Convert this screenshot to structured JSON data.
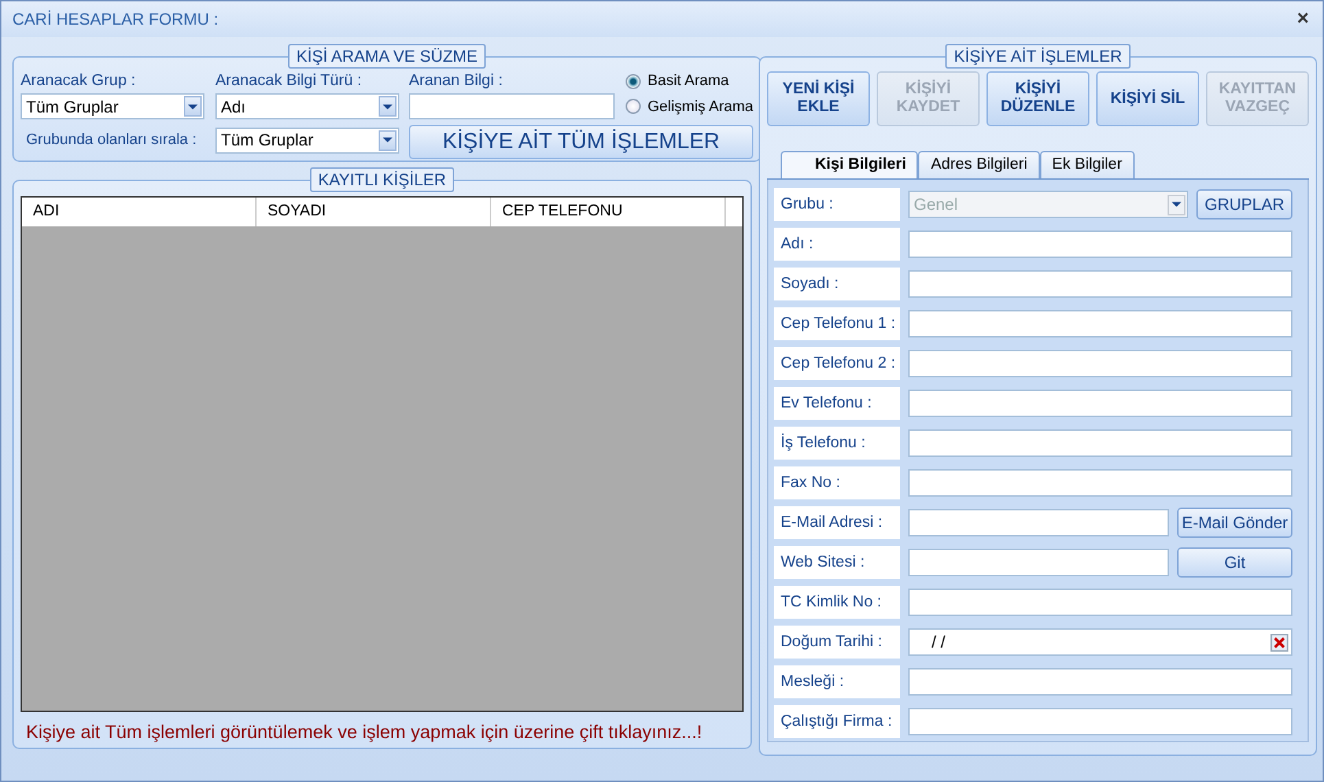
{
  "window": {
    "title": "CARİ HESAPLAR FORMU :",
    "close": "×"
  },
  "search": {
    "title": "KİŞİ ARAMA VE SÜZME",
    "group_label": "Aranacak Grup :",
    "group_value": "Tüm Gruplar",
    "type_label": "Aranacak Bilgi Türü :",
    "type_value": "Adı",
    "query_label": "Aranan Bilgi :",
    "modes": [
      {
        "label": "Basit Arama",
        "selected": true
      },
      {
        "label": "Gelişmiş Arama",
        "selected": false
      }
    ],
    "sort_label": "Grubunda olanları sırala :",
    "sort_value": "Tüm Gruplar",
    "all_button": "KİŞİYE AİT TÜM İŞLEMLER"
  },
  "list": {
    "title": "KAYITLI KİŞİLER",
    "columns": [
      "ADI",
      "SOYADI",
      "CEP TELEFONU"
    ],
    "hint": "Kişiye ait Tüm işlemleri görüntülemek ve işlem yapmak için üzerine çift tıklayınız...!"
  },
  "actions": {
    "title": "KİŞİYE AİT İŞLEMLER",
    "buttons": [
      {
        "label": "YENİ KİŞİ EKLE",
        "disabled": false
      },
      {
        "label": "KİŞİYİ KAYDET",
        "disabled": true
      },
      {
        "label": "KİŞİYİ DÜZENLE",
        "disabled": false
      },
      {
        "label": "KİŞİYİ SİL",
        "disabled": false
      },
      {
        "label": "KAYITTAN VAZGEÇ",
        "disabled": true
      }
    ],
    "tabs": [
      {
        "label": "Kişi Bilgileri",
        "selected": true
      },
      {
        "label": "Adres Bilgileri",
        "selected": false
      },
      {
        "label": "Ek Bilgiler",
        "selected": false
      }
    ],
    "fields": [
      {
        "label": "Grubu :",
        "kind": "combo",
        "value": "Genel",
        "disabled": true,
        "button": "GRUPLAR"
      },
      {
        "label": "Adı :",
        "kind": "text"
      },
      {
        "label": "Soyadı :",
        "kind": "text"
      },
      {
        "label": "Cep Telefonu 1 :",
        "kind": "text"
      },
      {
        "label": "Cep Telefonu 2 :",
        "kind": "text"
      },
      {
        "label": "Ev Telefonu :",
        "kind": "text"
      },
      {
        "label": "İş Telefonu :",
        "kind": "text"
      },
      {
        "label": "Fax No :",
        "kind": "text"
      },
      {
        "label": "E-Mail Adresi :",
        "kind": "text",
        "button": "E-Mail Gönder"
      },
      {
        "label": "Web Sitesi :",
        "kind": "text",
        "button": "Git"
      },
      {
        "label": "TC Kimlik No :",
        "kind": "text"
      },
      {
        "label": "Doğum Tarihi :",
        "kind": "date",
        "value": "/ /"
      },
      {
        "label": "Mesleği :",
        "kind": "text"
      },
      {
        "label": "Çalıştığı Firma :",
        "kind": "text"
      }
    ]
  }
}
